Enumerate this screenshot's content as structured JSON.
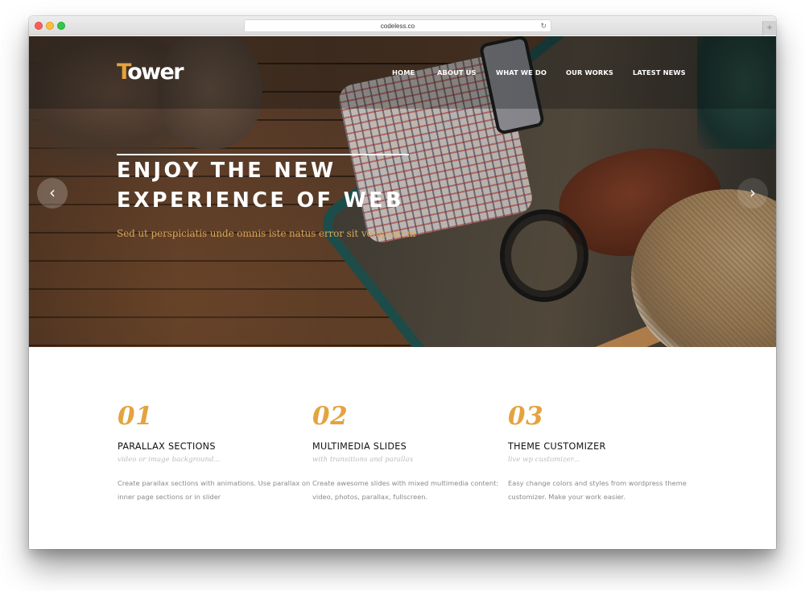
{
  "browser": {
    "url": "codeless.co",
    "reload_icon": "↻",
    "new_tab_icon": "+"
  },
  "site": {
    "logo": {
      "first_letter": "T",
      "rest": "ower"
    },
    "nav": [
      {
        "label": "HOME"
      },
      {
        "label": "ABOUT US"
      },
      {
        "label": "WHAT WE DO"
      },
      {
        "label": "OUR WORKS"
      },
      {
        "label": "LATEST NEWS"
      }
    ],
    "hero": {
      "title_line1": "ENJOY THE NEW",
      "title_line2": "EXPERIENCE OF WEB",
      "subtitle": "Sed ut perspiciatis unde omnis iste natus error sit voluptatem",
      "prev_icon": "‹",
      "next_icon": "›"
    },
    "features": [
      {
        "number": "01",
        "title": "PARALLAX SECTIONS",
        "subtitle": "video or image background...",
        "description": "Create parallax sections with animations. Use parallax on inner page sections or in slider"
      },
      {
        "number": "02",
        "title": "MULTIMEDIA SLIDES",
        "subtitle": "with transitions and parallax",
        "description": "Create awesome slides with mixed multimedia content: video, photos, parallax, fullscreen."
      },
      {
        "number": "03",
        "title": "THEME CUSTOMIZER",
        "subtitle": "live wp customizer...",
        "description": "Easy change colors and styles from wordpress theme customizer. Make your work easier."
      }
    ]
  },
  "colors": {
    "accent": "#e3a33f",
    "subtitle_gold": "#d9a55a",
    "title_dark": "#111111",
    "text_gray": "#8a8a8a"
  }
}
